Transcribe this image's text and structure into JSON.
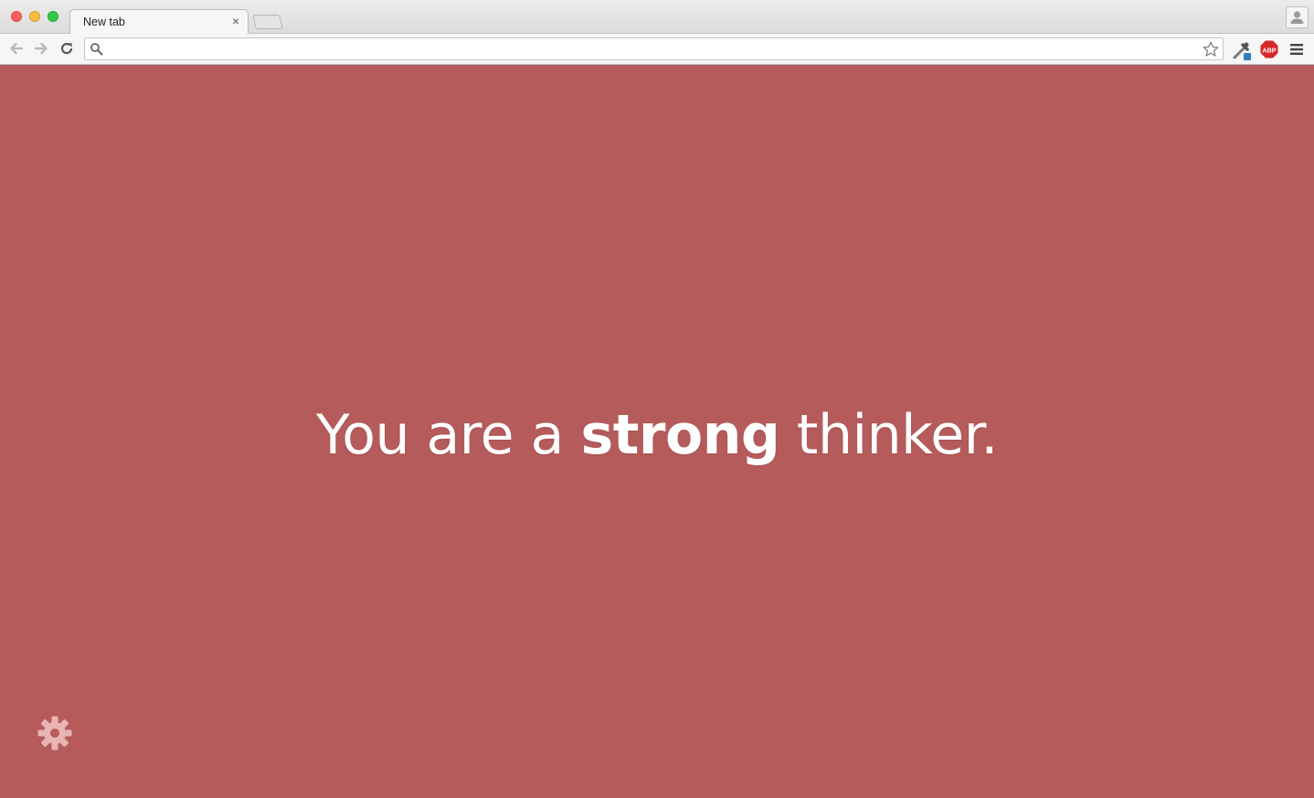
{
  "browser": {
    "tab": {
      "title": "New tab",
      "close_glyph": "×"
    },
    "omnibox": {
      "value": "",
      "placeholder": ""
    },
    "icons": {
      "back": "back-arrow-icon",
      "forward": "forward-arrow-icon",
      "reload": "reload-icon",
      "search": "search-icon",
      "bookmark": "star-icon",
      "dropper_extension": "eyedropper-icon",
      "adblock_extension": "abp-icon",
      "menu": "hamburger-menu-icon",
      "profile": "profile-icon"
    },
    "abp_label": "ABP"
  },
  "page": {
    "background_color": "#b55b5b",
    "message": {
      "before": "You are a ",
      "emphasis": "strong",
      "after": " thinker."
    },
    "settings_icon": "gear-icon"
  }
}
